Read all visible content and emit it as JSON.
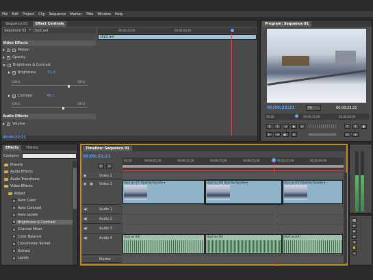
{
  "menubar": [
    "File",
    "Edit",
    "Project",
    "Clip",
    "Sequence",
    "Marker",
    "Title",
    "Window",
    "Help"
  ],
  "effect_controls": {
    "tabs": [
      "Sequence 01",
      "Effect Controls"
    ],
    "crumb_seq": "Sequence 01",
    "crumb_clip": "clip2.avi",
    "ruler": [
      "00;00;15;00",
      "00;00;20;00"
    ],
    "clip_label": "clip2.avi",
    "video_effects": "Video Effects",
    "motion": "Motion",
    "opacity": "Opacity",
    "brightness_contrast": "Brightness & Contrast",
    "brightness_label": "Brightness",
    "brightness_value": "51.6",
    "contrast_label": "Contrast",
    "contrast_value": "40.1",
    "range_min_b": "-100.0",
    "range_max_b": "100.0",
    "range_min_c": "-100.0",
    "range_max_c": "100.0",
    "audio_effects": "Audio Effects",
    "volume": "Volume",
    "timecode": "00;00;22;21"
  },
  "program": {
    "tab": "Program: Sequence 01",
    "timecode_current": "00;00;22;21",
    "fit": "Fit",
    "timecode_duration": "00;00;23;21",
    "ruler": [
      "00;00",
      "00;00;15;00",
      "00;00;20;00"
    ]
  },
  "effects": {
    "tabs": [
      "Effects",
      "History"
    ],
    "search_label": "Contains:",
    "items": [
      {
        "label": "Presets",
        "kind": "folder",
        "indent": 0
      },
      {
        "label": "Audio Effects",
        "kind": "folder",
        "indent": 0
      },
      {
        "label": "Audio Transitions",
        "kind": "folder",
        "indent": 0
      },
      {
        "label": "Video Effects",
        "kind": "folder",
        "indent": 0
      },
      {
        "label": "Adjust",
        "kind": "folder",
        "indent": 1
      },
      {
        "label": "Auto Color",
        "kind": "fx",
        "indent": 2
      },
      {
        "label": "Auto Contrast",
        "kind": "fx",
        "indent": 2
      },
      {
        "label": "Auto Levels",
        "kind": "fx",
        "indent": 2
      },
      {
        "label": "Brightness & Contrast",
        "kind": "fx",
        "indent": 2,
        "selected": true
      },
      {
        "label": "Channel Mixer",
        "kind": "fx",
        "indent": 2
      },
      {
        "label": "Color Balance",
        "kind": "fx",
        "indent": 2
      },
      {
        "label": "Convolution Kernel",
        "kind": "fx",
        "indent": 2
      },
      {
        "label": "Extract",
        "kind": "fx",
        "indent": 2
      },
      {
        "label": "Levels",
        "kind": "fx",
        "indent": 2
      }
    ]
  },
  "timeline": {
    "tab": "Timeline: Sequence 01",
    "timecode": "00;00;22;21",
    "ruler": [
      "00;00",
      "00;00;05;00",
      "00;00;10;00",
      "00;00;15;00",
      "00;00;20;00",
      "00;00;25;00",
      "00;00;30;00"
    ],
    "tracks": {
      "video2": "Video 2",
      "video1": "Video 1",
      "audio1": "Audio 1",
      "audio2": "Audio 2",
      "audio3": "Audio 3",
      "audio4": "Audio 4",
      "master": "Master"
    },
    "clips": [
      {
        "label": "clip1.avi [V] Opacity:Opacity ▾"
      },
      {
        "label": "clip2.avi [V] Opacity:Opacity ▾"
      },
      {
        "label": "clip3.avi [V] Opacity:Opacity ▾"
      }
    ],
    "audio_clips": [
      {
        "label": "clip1.avi [A]"
      },
      {
        "label": "clip2.avi [A]"
      },
      {
        "label": "clip3.avi [A]"
      }
    ]
  },
  "tools": [
    "↖",
    "↔",
    "⇄",
    "✂",
    "↕",
    "✋",
    "⌕"
  ]
}
